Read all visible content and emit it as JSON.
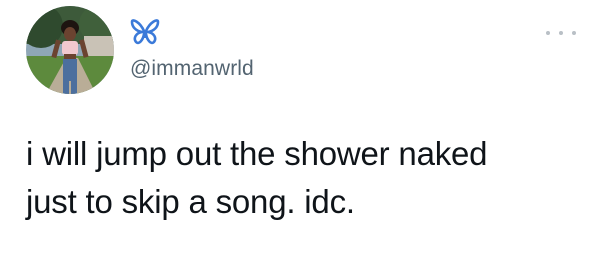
{
  "tweet": {
    "display_name_icon": "butterfly-icon",
    "handle": "@immanwrld",
    "text_lines": [
      "i will jump out the shower naked",
      "just to skip a song. idc."
    ],
    "more_icon": "more-options-icon"
  },
  "colors": {
    "butterfly": "#3b7ad9",
    "handle": "#536471",
    "text": "#0f1419",
    "dots": "#b9c0c6"
  }
}
